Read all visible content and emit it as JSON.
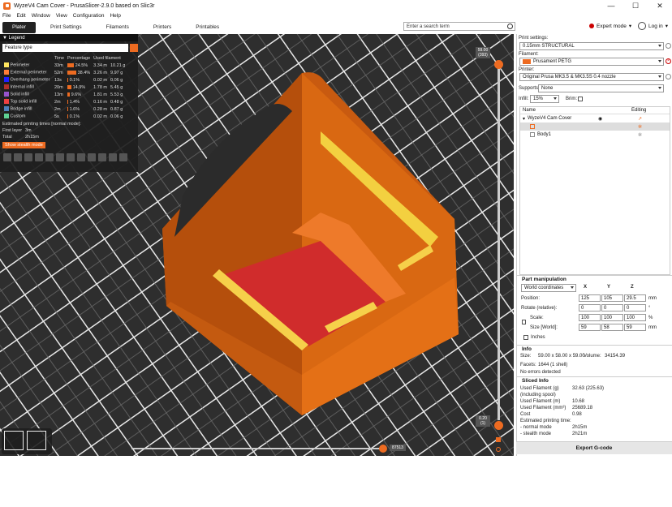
{
  "window": {
    "title": "WyzeV4 Cam Cover - PrusaSlicer-2.9.0 based on Slic3r",
    "minimize": "—",
    "maximize": "☐",
    "close": "✕"
  },
  "menu": [
    "File",
    "Edit",
    "Window",
    "View",
    "Configuration",
    "Help"
  ],
  "tabs": [
    "Plater",
    "Print Settings",
    "Filaments",
    "Printers",
    "Printables"
  ],
  "search": {
    "placeholder": "Enter a search term"
  },
  "mode": {
    "label": "Expert mode",
    "color": "#cc0000"
  },
  "login": {
    "label": "Log in"
  },
  "legend": {
    "title": "Legend",
    "view_type": "Feature type",
    "columns": [
      "",
      "Time",
      "Percentage",
      "Used filament"
    ],
    "rows": [
      {
        "name": "Perimeter",
        "color": "#ffe65f",
        "time": "33m",
        "pct": "24.5%",
        "bar": 0.25,
        "len": "3.34 m",
        "wt": "10.21 g"
      },
      {
        "name": "External perimeter",
        "color": "#ff7d38",
        "time": "52m",
        "pct": "38.4%",
        "bar": 0.38,
        "len": "3.26 m",
        "wt": "9.97 g"
      },
      {
        "name": "Overhang perimeter",
        "color": "#1f1fff",
        "time": "13s",
        "pct": "0.1%",
        "bar": 0.01,
        "len": "0.02 m",
        "wt": "0.06 g"
      },
      {
        "name": "Internal infill",
        "color": "#b03029",
        "time": "20m",
        "pct": "14.9%",
        "bar": 0.15,
        "len": "1.78 m",
        "wt": "5.45 g"
      },
      {
        "name": "Solid infill",
        "color": "#9654cc",
        "time": "13m",
        "pct": "9.6%",
        "bar": 0.1,
        "len": "1.81 m",
        "wt": "5.53 g"
      },
      {
        "name": "Top solid infill",
        "color": "#f04040",
        "time": "2m",
        "pct": "1.4%",
        "bar": 0.02,
        "len": "0.16 m",
        "wt": "0.48 g"
      },
      {
        "name": "Bridge infill",
        "color": "#4d80ba",
        "time": "2m",
        "pct": "1.6%",
        "bar": 0.02,
        "len": "0.28 m",
        "wt": "0.87 g"
      },
      {
        "name": "Custom",
        "color": "#5ed194",
        "time": "5s",
        "pct": "0.1%",
        "bar": 0.01,
        "len": "0.02 m",
        "wt": "0.06 g"
      }
    ],
    "est_title": "Estimated printing times [normal mode]:",
    "first_layer_label": "First layer",
    "first_layer": "3m",
    "total_label": "Total",
    "total": "2h15m",
    "stealth_button": "Show stealth mode"
  },
  "sliders": {
    "top_label": "59.00",
    "top_sub": "(393)",
    "bottom_label": "0.20",
    "bottom_sub": "(1)",
    "h_label": "87513"
  },
  "panel": {
    "print_settings_label": "Print settings:",
    "print_settings": "0.15mm STRUCTURAL",
    "filament_label": "Filament:",
    "filament": "Prusament PETG",
    "filament_color": "#ed6b21",
    "printer_label": "Printer:",
    "printer": "Original Prusa MK3.5 & MK3.5S 0.4 nozzle",
    "supports_label": "Supports:",
    "supports": "None",
    "infill_label": "Infill:",
    "infill": "15%",
    "brim_label": "Brim:",
    "list_cols": [
      "Name",
      "Editing"
    ],
    "objects": [
      "WyzeV4 Cam Cover",
      "Body1"
    ],
    "objects_selected": "Body1",
    "pm_title": "Part manipulation",
    "coords": "World coordinates",
    "axes": [
      "X",
      "Y",
      "Z"
    ],
    "position_label": "Position:",
    "position": [
      "125",
      "105",
      "29.5"
    ],
    "position_unit": "mm",
    "rotate_label": "Rotate (relative):",
    "rotate": [
      "0",
      "0",
      "0"
    ],
    "rotate_unit": "°",
    "scale_label": "Scale:",
    "scale": [
      "100",
      "100",
      "100"
    ],
    "scale_unit": "%",
    "size_label": "Size [World]:",
    "size": [
      "59",
      "58",
      "59"
    ],
    "size_unit": "mm",
    "inches_label": "Inches",
    "info_title": "Info",
    "info_size_label": "Size:",
    "info_size": "59.00 x 58.00 x 59.00",
    "info_volume_label": "Volume:",
    "info_volume": "34154.39",
    "info_facets_label": "Facets:",
    "info_facets": "1644 (1 shell)",
    "info_errors": "No errors detected",
    "sliced_title": "Sliced Info",
    "sliced": [
      [
        "Used Filament (g)",
        "32.63 (225.63)"
      ],
      [
        "   (including spool)",
        ""
      ],
      [
        "Used Filament (m)",
        "10.68"
      ],
      [
        "Used Filament (mm³)",
        "25689.18"
      ],
      [
        "Cost",
        "0.98"
      ],
      [
        "Estimated printing time:",
        ""
      ],
      [
        " - normal mode",
        "2h15m"
      ],
      [
        " - stealth mode",
        "2h21m"
      ]
    ],
    "export": "Export G-code"
  }
}
